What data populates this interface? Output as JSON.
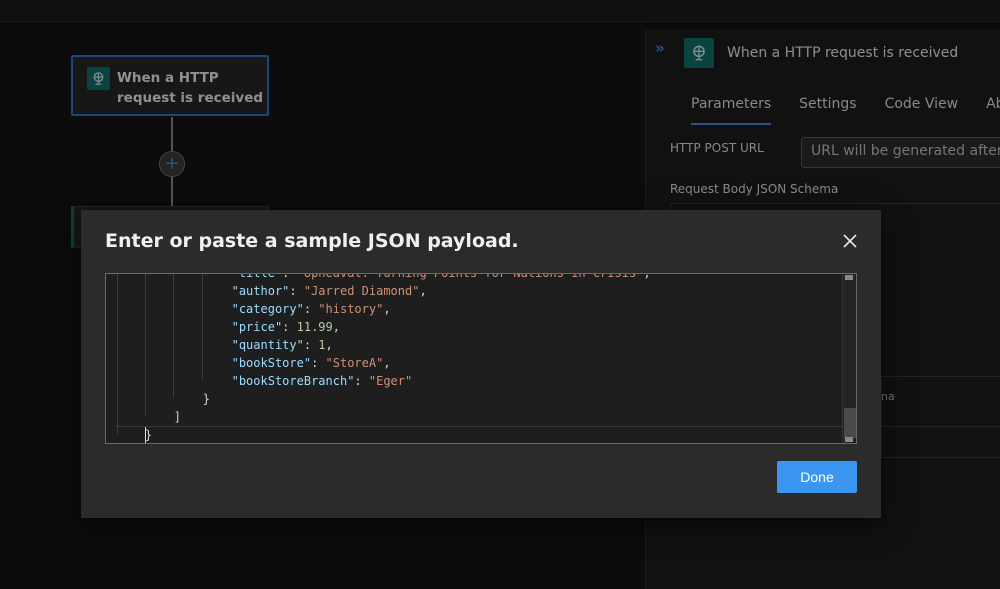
{
  "canvas": {
    "trigger_node": {
      "title": "When a HTTP request is received",
      "icon": "http-trigger-icon"
    },
    "add_step": {
      "icon": "plus-icon",
      "glyph": "+"
    }
  },
  "panel": {
    "collapse_glyph": "»",
    "title": "When a HTTP request is received",
    "icon": "http-trigger-icon",
    "tabs": [
      {
        "label": "Parameters",
        "active": true
      },
      {
        "label": "Settings",
        "active": false
      },
      {
        "label": "Code View",
        "active": false
      },
      {
        "label": "About",
        "active": false
      }
    ],
    "http_post_url_label": "HTTP POST URL",
    "url_value": "URL will be generated after save",
    "schema_label": "Request Body JSON Schema",
    "schema_partial_text": "na"
  },
  "dialog": {
    "title": "Enter or paste a sample JSON payload.",
    "close_icon": "close-icon",
    "done_label": "Done",
    "accent_color": "#3a96f0",
    "code_lines": [
      {
        "text": "\"title\": \"Upheaval: Turning Points for Nations in Crisis\",",
        "key": "\"title\"",
        "value": "\"Upheaval: Turning Points for Nations in Crisis\"",
        "type": "str"
      },
      {
        "key": "\"author\"",
        "value": "\"Jarred Diamond\"",
        "type": "str"
      },
      {
        "key": "\"category\"",
        "value": "\"history\"",
        "type": "str"
      },
      {
        "key": "\"price\"",
        "value": "11.99",
        "type": "num"
      },
      {
        "key": "\"quantity\"",
        "value": "1",
        "type": "num"
      },
      {
        "key": "\"bookStore\"",
        "value": "\"StoreA\"",
        "type": "str"
      },
      {
        "key": "\"bookStoreBranch\"",
        "value": "\"Eger\"",
        "type": "str",
        "last": true
      },
      {
        "bracket": "}"
      },
      {
        "bracket": "]"
      },
      {
        "bracket": "}"
      }
    ]
  }
}
